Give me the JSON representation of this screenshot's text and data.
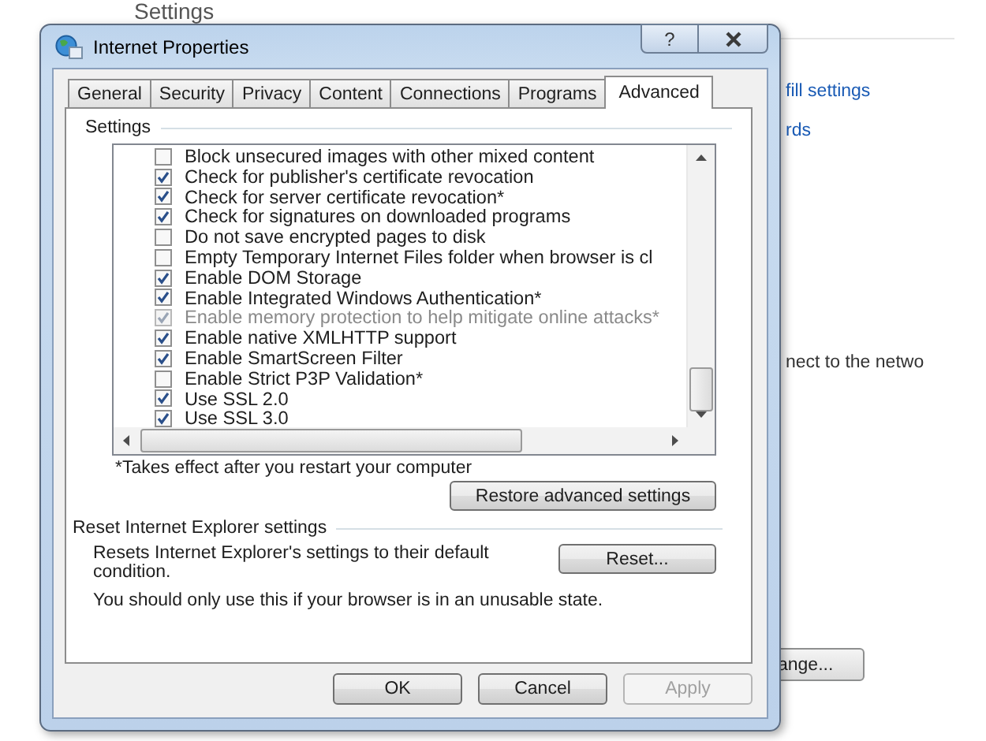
{
  "background": {
    "heading": "Settings",
    "texts": [
      {
        "text": "fill settings",
        "kind": "link"
      },
      {
        "text": "rds",
        "kind": "link"
      },
      {
        "text": "nect to the netwo",
        "kind": "text"
      }
    ],
    "button": "ange..."
  },
  "window": {
    "title": "Internet Properties",
    "help": "?"
  },
  "tabs": [
    {
      "label": "General",
      "selected": false
    },
    {
      "label": "Security",
      "selected": false
    },
    {
      "label": "Privacy",
      "selected": false
    },
    {
      "label": "Content",
      "selected": false
    },
    {
      "label": "Connections",
      "selected": false
    },
    {
      "label": "Programs",
      "selected": false
    },
    {
      "label": "Advanced",
      "selected": true
    }
  ],
  "settings_group": {
    "label": "Settings",
    "items": [
      {
        "label": "Block unsecured images with other mixed content",
        "checked": false,
        "disabled": false
      },
      {
        "label": "Check for publisher's certificate revocation",
        "checked": true,
        "disabled": false
      },
      {
        "label": "Check for server certificate revocation*",
        "checked": true,
        "disabled": false
      },
      {
        "label": "Check for signatures on downloaded programs",
        "checked": true,
        "disabled": false
      },
      {
        "label": "Do not save encrypted pages to disk",
        "checked": false,
        "disabled": false
      },
      {
        "label": "Empty Temporary Internet Files folder when browser is cl",
        "checked": false,
        "disabled": false
      },
      {
        "label": "Enable DOM Storage",
        "checked": true,
        "disabled": false
      },
      {
        "label": "Enable Integrated Windows Authentication*",
        "checked": true,
        "disabled": false
      },
      {
        "label": "Enable memory protection to help mitigate online attacks*",
        "checked": true,
        "disabled": true
      },
      {
        "label": "Enable native XMLHTTP support",
        "checked": true,
        "disabled": false
      },
      {
        "label": "Enable SmartScreen Filter",
        "checked": true,
        "disabled": false
      },
      {
        "label": "Enable Strict P3P Validation*",
        "checked": false,
        "disabled": false
      },
      {
        "label": "Use SSL 2.0",
        "checked": true,
        "disabled": false
      },
      {
        "label": "Use SSL 3.0",
        "checked": true,
        "disabled": false
      }
    ],
    "footnote": "*Takes effect after you restart your computer",
    "restore_button": "Restore advanced settings"
  },
  "reset_group": {
    "label": "Reset Internet Explorer settings",
    "description": "Resets Internet Explorer's settings to their default condition.",
    "reset_button": "Reset...",
    "note": "You should only use this if your browser is in an unusable state."
  },
  "buttons": [
    {
      "label": "OK",
      "disabled": false
    },
    {
      "label": "Cancel",
      "disabled": false
    },
    {
      "label": "Apply",
      "disabled": true
    }
  ]
}
